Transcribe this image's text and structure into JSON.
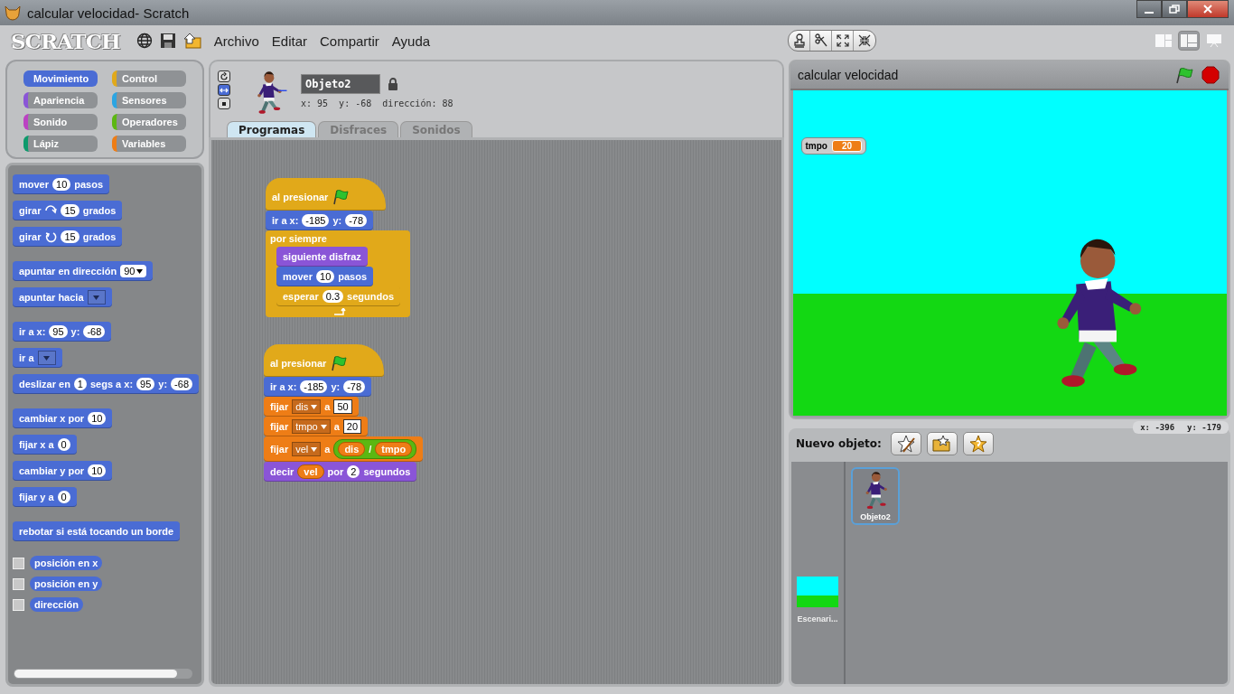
{
  "window": {
    "title": "calcular velocidad- Scratch"
  },
  "logo": "SCRATCH",
  "menu": [
    "Archivo",
    "Editar",
    "Compartir",
    "Ayuda"
  ],
  "categories": [
    {
      "label": "Movimiento",
      "color": "#4a6cd4",
      "selected": true
    },
    {
      "label": "Control",
      "color": "#e1a91a",
      "selected": false
    },
    {
      "label": "Apariencia",
      "color": "#8a55d7",
      "selected": false
    },
    {
      "label": "Sensores",
      "color": "#2ca5e2",
      "selected": false
    },
    {
      "label": "Sonido",
      "color": "#bb42c3",
      "selected": false
    },
    {
      "label": "Operadores",
      "color": "#5cb712",
      "selected": false
    },
    {
      "label": "Lápiz",
      "color": "#0e9a6c",
      "selected": false
    },
    {
      "label": "Variables",
      "color": "#ee7d16",
      "selected": false
    }
  ],
  "palette": [
    [
      {
        "kind": "stack",
        "color": "#4a6cd4",
        "parts": [
          {
            "kind": "text",
            "text": "mover"
          },
          {
            "kind": "number",
            "text": "10"
          },
          {
            "kind": "text",
            "text": "pasos"
          }
        ]
      },
      {
        "kind": "stack",
        "color": "#4a6cd4",
        "parts": [
          {
            "kind": "text",
            "text": "girar"
          },
          {
            "kind": "turn_right"
          },
          {
            "kind": "number",
            "text": "15"
          },
          {
            "kind": "text",
            "text": "grados"
          }
        ]
      },
      {
        "kind": "stack",
        "color": "#4a6cd4",
        "parts": [
          {
            "kind": "text",
            "text": "girar"
          },
          {
            "kind": "turn_left"
          },
          {
            "kind": "number",
            "text": "15"
          },
          {
            "kind": "text",
            "text": "grados"
          }
        ]
      }
    ],
    [
      {
        "kind": "stack",
        "color": "#4a6cd4",
        "parts": [
          {
            "kind": "text",
            "text": "apuntar en dirección"
          },
          {
            "kind": "dropdown",
            "text": "90"
          }
        ]
      },
      {
        "kind": "stack",
        "color": "#4a6cd4",
        "parts": [
          {
            "kind": "text",
            "text": "apuntar hacia"
          },
          {
            "kind": "menu"
          }
        ]
      }
    ],
    [
      {
        "kind": "stack",
        "color": "#4a6cd4",
        "parts": [
          {
            "kind": "text",
            "text": "ir a x:"
          },
          {
            "kind": "number",
            "text": "95"
          },
          {
            "kind": "text",
            "text": "y:"
          },
          {
            "kind": "number",
            "text": "-68"
          }
        ]
      },
      {
        "kind": "stack",
        "color": "#4a6cd4",
        "parts": [
          {
            "kind": "text",
            "text": "ir a"
          },
          {
            "kind": "menu"
          }
        ]
      },
      {
        "kind": "stack",
        "color": "#4a6cd4",
        "parts": [
          {
            "kind": "text",
            "text": "deslizar en"
          },
          {
            "kind": "number",
            "text": "1"
          },
          {
            "kind": "text",
            "text": "segs a x:"
          },
          {
            "kind": "number",
            "text": "95"
          },
          {
            "kind": "text",
            "text": "y:"
          },
          {
            "kind": "number",
            "text": "-68"
          }
        ]
      }
    ],
    [
      {
        "kind": "stack",
        "color": "#4a6cd4",
        "parts": [
          {
            "kind": "text",
            "text": "cambiar x por"
          },
          {
            "kind": "number",
            "text": "10"
          }
        ]
      },
      {
        "kind": "stack",
        "color": "#4a6cd4",
        "parts": [
          {
            "kind": "text",
            "text": "fijar x a"
          },
          {
            "kind": "number",
            "text": "0"
          }
        ]
      },
      {
        "kind": "stack",
        "color": "#4a6cd4",
        "parts": [
          {
            "kind": "text",
            "text": "cambiar y por"
          },
          {
            "kind": "number",
            "text": "10"
          }
        ]
      },
      {
        "kind": "stack",
        "color": "#4a6cd4",
        "parts": [
          {
            "kind": "text",
            "text": "fijar y a"
          },
          {
            "kind": "number",
            "text": "0"
          }
        ]
      }
    ],
    [
      {
        "kind": "stack",
        "color": "#4a6cd4",
        "parts": [
          {
            "kind": "text",
            "text": "rebotar si está tocando un borde"
          }
        ]
      }
    ],
    [
      {
        "kind": "reporter",
        "color": "#4a6cd4",
        "label": "posición en x",
        "checked": false
      },
      {
        "kind": "reporter",
        "color": "#4a6cd4",
        "label": "posición en y",
        "checked": false
      },
      {
        "kind": "reporter",
        "color": "#4a6cd4",
        "label": "dirección",
        "checked": false
      }
    ]
  ],
  "sprite": {
    "name": "Objeto2",
    "x": "x: 95",
    "y": "y: -68",
    "direction": "dirección: 88",
    "rotation_styles": [
      {
        "selected": false
      },
      {
        "selected": true
      },
      {
        "selected": false
      }
    ]
  },
  "tabs": [
    {
      "label": "Programas",
      "selected": true
    },
    {
      "label": "Disfraces",
      "selected": false
    },
    {
      "label": "Sonidos",
      "selected": false
    }
  ],
  "scripts": [
    {
      "blocks": [
        {
          "kind": "hat",
          "color": "#e1a91a",
          "parts": [
            {
              "kind": "text",
              "text": "al presionar"
            },
            {
              "kind": "flag"
            }
          ]
        },
        {
          "kind": "stack",
          "color": "#4a6cd4",
          "parts": [
            {
              "kind": "text",
              "text": "ir a x:"
            },
            {
              "kind": "number",
              "text": "-185"
            },
            {
              "kind": "text",
              "text": "y:"
            },
            {
              "kind": "number",
              "text": "-78"
            }
          ]
        },
        {
          "kind": "c",
          "color": "#e1a91a",
          "parts": [
            {
              "kind": "text",
              "text": "por siempre"
            }
          ],
          "children": [
            {
              "kind": "stack",
              "color": "#8a55d7",
              "parts": [
                {
                  "kind": "text",
                  "text": "siguiente disfraz"
                }
              ]
            },
            {
              "kind": "stack",
              "color": "#4a6cd4",
              "parts": [
                {
                  "kind": "text",
                  "text": "mover"
                },
                {
                  "kind": "number",
                  "text": "10"
                },
                {
                  "kind": "text",
                  "text": "pasos"
                }
              ]
            },
            {
              "kind": "stack",
              "color": "#e1a91a",
              "parts": [
                {
                  "kind": "text",
                  "text": "esperar"
                },
                {
                  "kind": "number",
                  "text": "0.3"
                },
                {
                  "kind": "text",
                  "text": "segundos"
                }
              ]
            }
          ]
        }
      ]
    },
    {
      "blocks": [
        {
          "kind": "hat",
          "color": "#e1a91a",
          "parts": [
            {
              "kind": "text",
              "text": "al presionar"
            },
            {
              "kind": "flag"
            }
          ]
        },
        {
          "kind": "stack",
          "color": "#4a6cd4",
          "parts": [
            {
              "kind": "text",
              "text": "ir a x:"
            },
            {
              "kind": "number",
              "text": "-185"
            },
            {
              "kind": "text",
              "text": "y:"
            },
            {
              "kind": "number",
              "text": "-78"
            }
          ]
        },
        {
          "kind": "stack",
          "color": "#ee7d16",
          "parts": [
            {
              "kind": "text",
              "text": "fijar"
            },
            {
              "kind": "varmenu",
              "text": "dis"
            },
            {
              "kind": "text",
              "text": "a"
            },
            {
              "kind": "string",
              "text": "50"
            }
          ]
        },
        {
          "kind": "stack",
          "color": "#ee7d16",
          "parts": [
            {
              "kind": "text",
              "text": "fijar"
            },
            {
              "kind": "varmenu",
              "text": "tmpo"
            },
            {
              "kind": "text",
              "text": "a"
            },
            {
              "kind": "string",
              "text": "20"
            }
          ]
        },
        {
          "kind": "stack",
          "color": "#ee7d16",
          "parts": [
            {
              "kind": "text",
              "text": "fijar"
            },
            {
              "kind": "varmenu",
              "text": "vel"
            },
            {
              "kind": "text",
              "text": "a"
            },
            {
              "kind": "op",
              "parts": [
                {
                  "kind": "var",
                  "text": "dis"
                },
                {
                  "kind": "text",
                  "text": "/"
                },
                {
                  "kind": "var",
                  "text": "tmpo"
                }
              ]
            }
          ]
        },
        {
          "kind": "stack",
          "color": "#8a55d7",
          "parts": [
            {
              "kind": "text",
              "text": "decir"
            },
            {
              "kind": "var",
              "text": "vel"
            },
            {
              "kind": "text",
              "text": "por"
            },
            {
              "kind": "number",
              "text": "2"
            },
            {
              "kind": "text",
              "text": "segundos"
            }
          ]
        }
      ]
    }
  ],
  "view_modes": [
    {
      "selected": false
    },
    {
      "selected": true
    },
    {
      "selected": false
    }
  ],
  "stage": {
    "title": "calcular velocidad",
    "monitors": [
      {
        "label": "tmpo",
        "value": "20"
      }
    ],
    "mouse_x": "x: -396",
    "mouse_y": "y: -179"
  },
  "new_sprite": {
    "label": "Nuevo objeto:"
  },
  "sprites": [
    {
      "name": "Objeto2",
      "selected": true
    }
  ],
  "stage_thumb": {
    "name": "Escenari..."
  }
}
